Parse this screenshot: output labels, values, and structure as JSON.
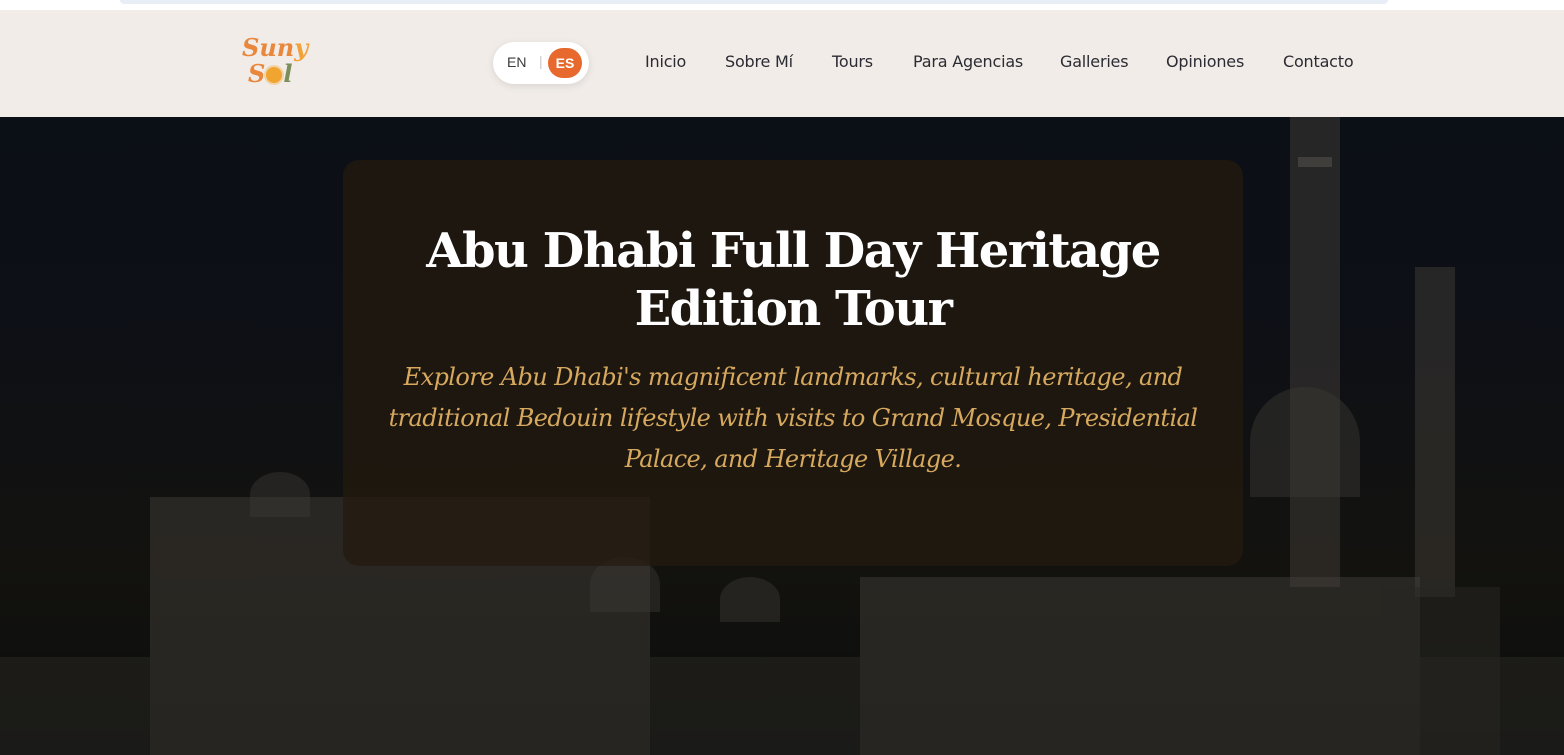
{
  "brand": {
    "logo_line1_a": "Sun",
    "logo_line1_b": "y",
    "logo_line2_a": "S",
    "logo_line2_b": "l",
    "accent": "#e8692e"
  },
  "language": {
    "en_label": "EN",
    "separator": "|",
    "es_label": "ES",
    "active": "ES"
  },
  "nav": {
    "items": [
      {
        "label": "Inicio"
      },
      {
        "label": "Sobre Mí"
      },
      {
        "label": "Tours"
      },
      {
        "label": "Para Agencias"
      },
      {
        "label": "Galleries"
      },
      {
        "label": "Opiniones"
      },
      {
        "label": "Contacto"
      }
    ]
  },
  "hero": {
    "title": "Abu Dhabi Full Day Heritage Edition Tour",
    "subtitle": "Explore Abu Dhabi's magnificent landmarks, cultural heritage, and traditional Bedouin lifestyle with visits to Grand Mosque, Presidential Palace, and Heritage Village.",
    "title_color": "#ffffff",
    "subtitle_color": "#d7a95f"
  }
}
